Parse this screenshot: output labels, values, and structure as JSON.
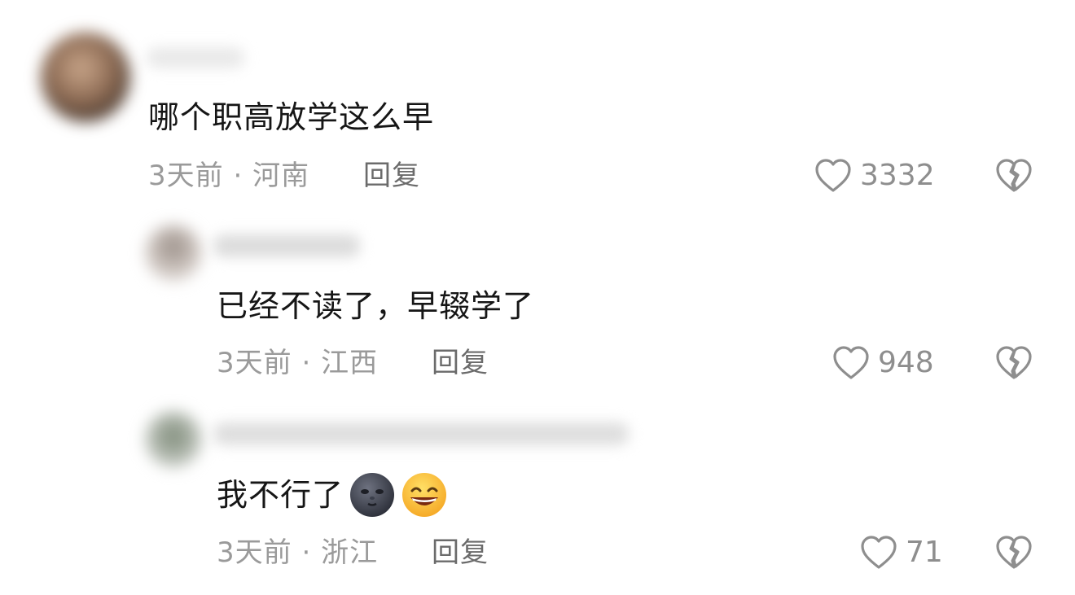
{
  "comments": [
    {
      "text": "哪个职高放学这么早",
      "time": "3天前",
      "separator": "·",
      "location": "河南",
      "reply": "回复",
      "likes": "3332"
    },
    {
      "text": "已经不读了，早辍学了",
      "time": "3天前",
      "separator": "·",
      "location": "江西",
      "reply": "回复",
      "likes": "948"
    },
    {
      "text": "我不行了",
      "emojis": [
        "new-moon-face",
        "grinning-face"
      ],
      "time": "3天前",
      "separator": "·",
      "location": "浙江",
      "reply": "回复",
      "likes": "71"
    }
  ],
  "colors": {
    "text": "#161616",
    "meta": "#9a9a9a",
    "reply": "#6b6b6b",
    "icon": "#8e8e8e"
  }
}
